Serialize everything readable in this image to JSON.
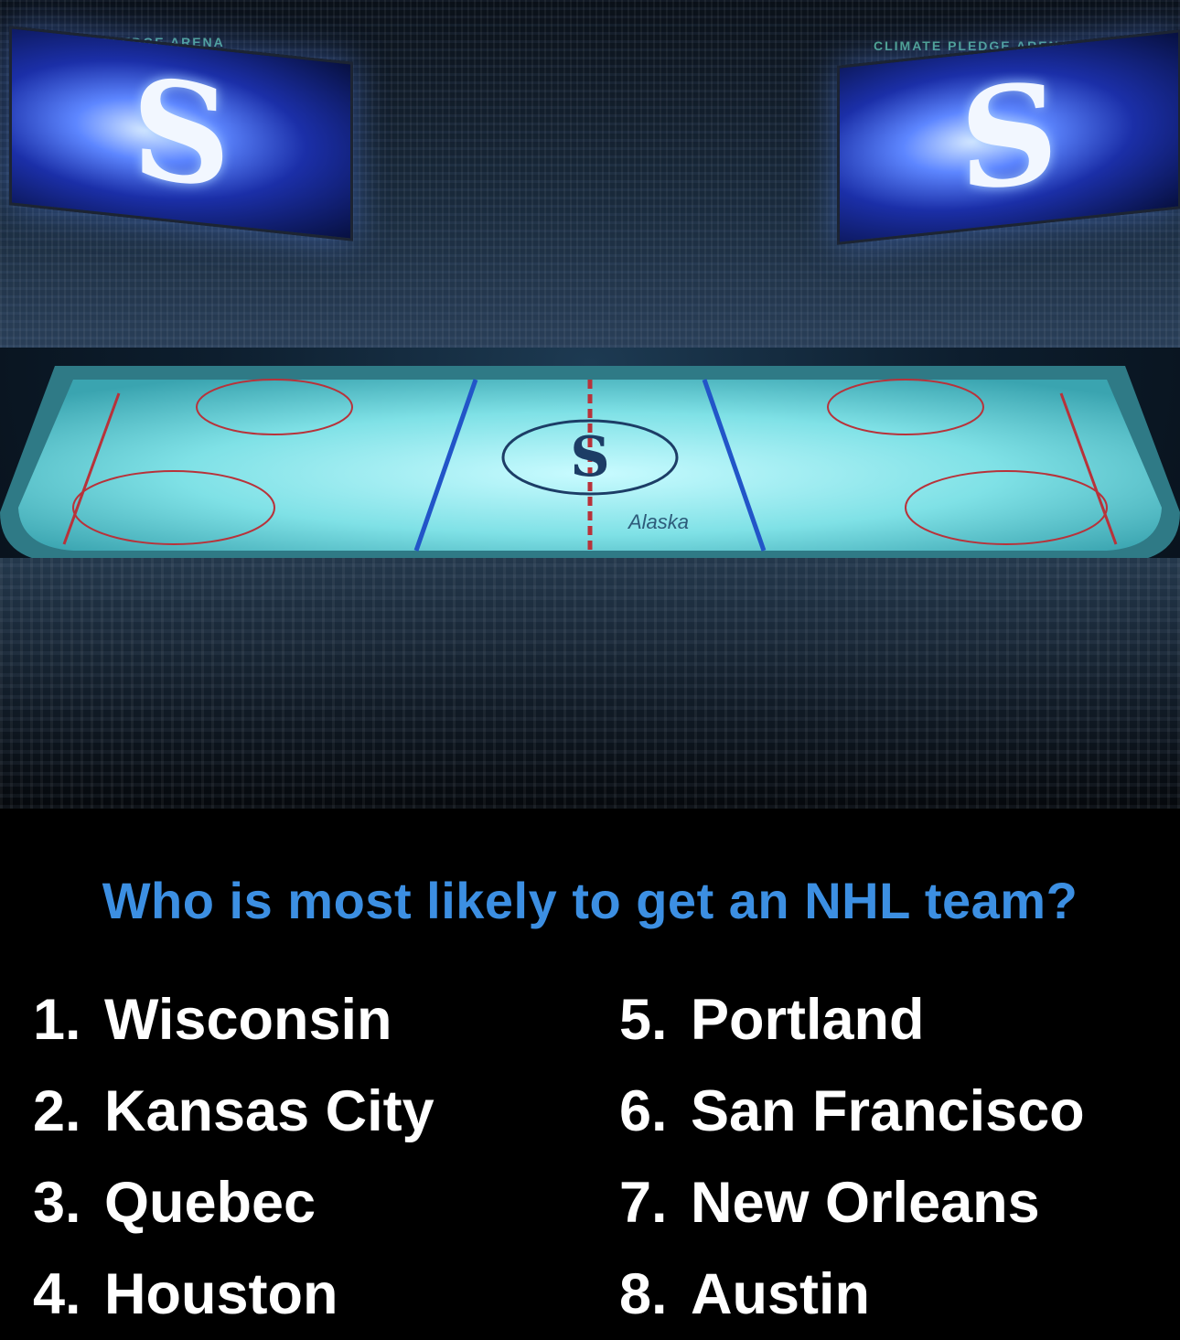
{
  "photo": {
    "description_icon": "hockey-arena-icon",
    "jumbotron_logo": "S",
    "banner_text": "CLIMATE PLEDGE ARENA",
    "rink_logo_text": "Alaska"
  },
  "question": "Who is most likely to get an NHL team?",
  "colors": {
    "question": "#3c8fe2",
    "list_text": "#ffffff",
    "background": "#000000"
  },
  "options_left": [
    {
      "num": "1.",
      "name": "Wisconsin"
    },
    {
      "num": "2.",
      "name": "Kansas City"
    },
    {
      "num": "3.",
      "name": "Quebec"
    },
    {
      "num": "4.",
      "name": "Houston"
    }
  ],
  "options_right": [
    {
      "num": "5.",
      "name": "Portland"
    },
    {
      "num": "6.",
      "name": "San Francisco"
    },
    {
      "num": "7.",
      "name": "New Orleans"
    },
    {
      "num": "8.",
      "name": "Austin"
    }
  ]
}
